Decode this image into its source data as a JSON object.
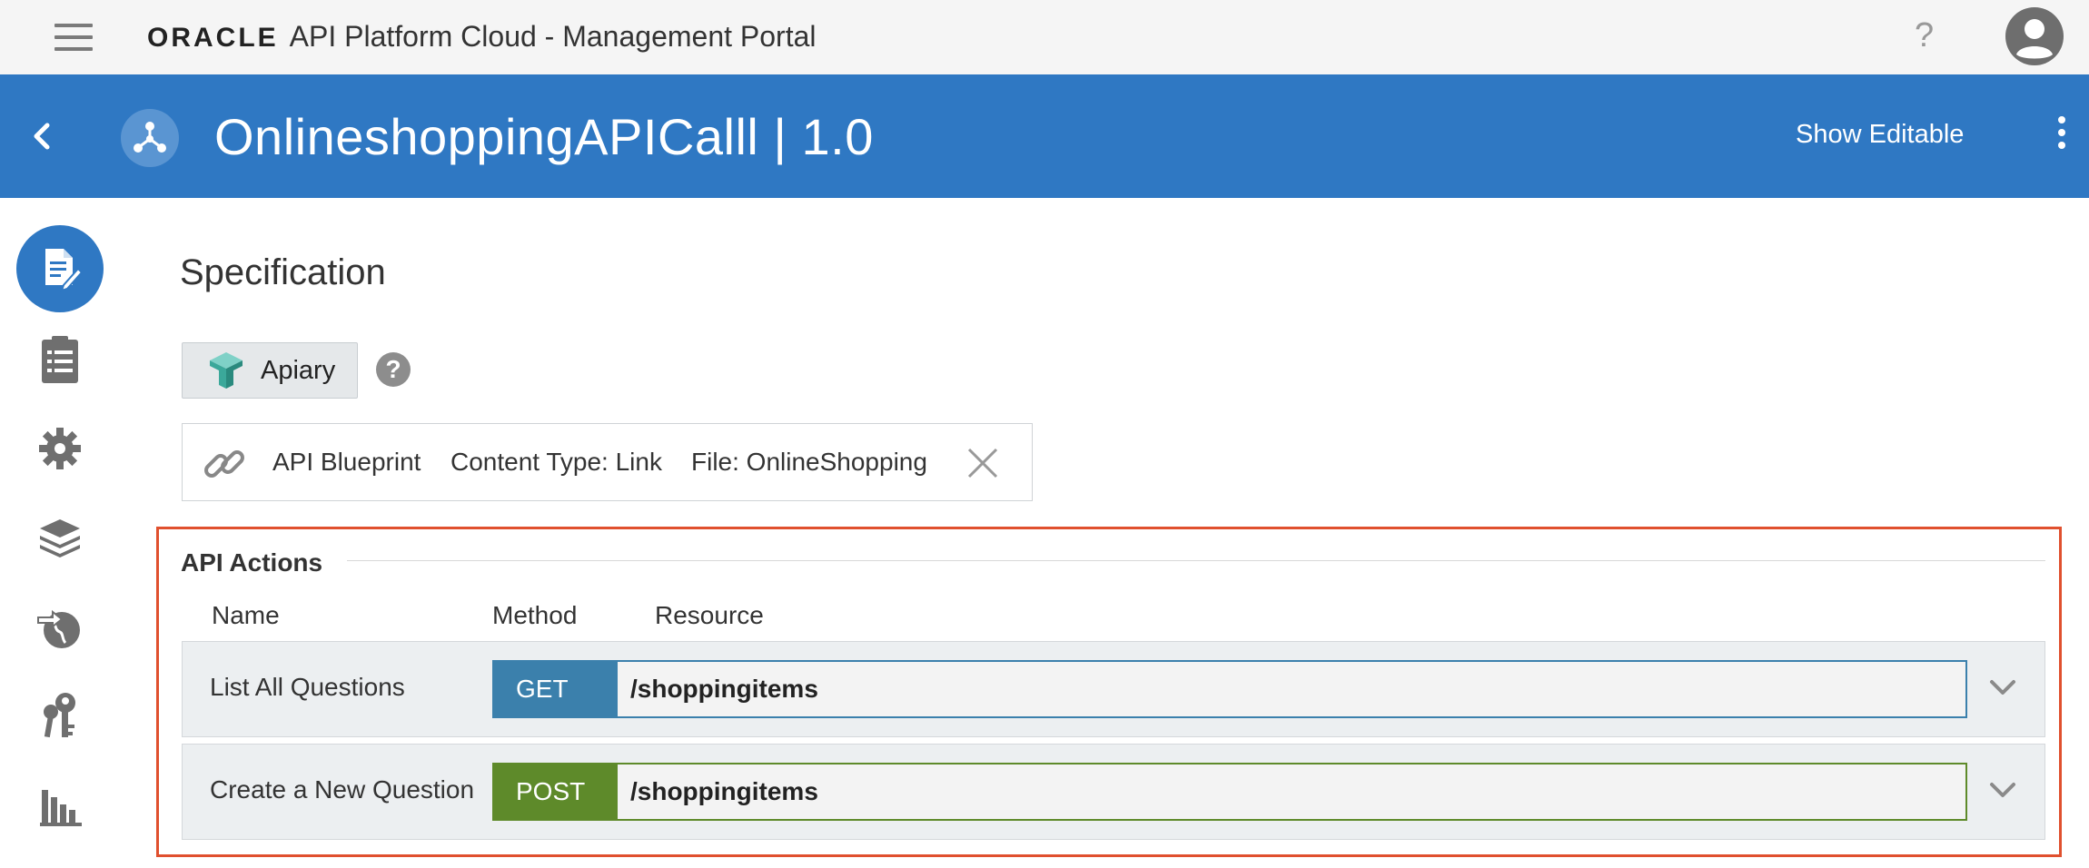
{
  "topbar": {
    "brand_logo": "ORACLE",
    "app_title": "API Platform Cloud - Management Portal",
    "help_label": "?"
  },
  "header": {
    "api_title": "OnlineshoppingAPICalll | 1.0",
    "show_editable": "Show Editable"
  },
  "sidebar": {
    "items": [
      {
        "icon": "document-edit-icon",
        "active": true
      },
      {
        "icon": "clipboard-list-icon",
        "active": false
      },
      {
        "icon": "gear-icon",
        "active": false
      },
      {
        "icon": "layers-icon",
        "active": false
      },
      {
        "icon": "globe-deploy-icon",
        "active": false
      },
      {
        "icon": "keys-icon",
        "active": false
      },
      {
        "icon": "bar-chart-icon",
        "active": false
      }
    ]
  },
  "main": {
    "section_title": "Specification",
    "apiary_button": "Apiary",
    "help_label": "?",
    "spec_file": {
      "format": "API Blueprint",
      "content_type": "Content Type: Link",
      "file": "File: OnlineShopping"
    },
    "api_actions": {
      "title": "API Actions",
      "columns": {
        "name": "Name",
        "method": "Method",
        "resource": "Resource"
      },
      "rows": [
        {
          "name": "List All Questions",
          "method": "GET",
          "resource": "/shoppingitems",
          "method_color": "#3b80ac",
          "border_color": "#3b80ac"
        },
        {
          "name": "Create a New Question",
          "method": "POST",
          "resource": "/shoppingitems",
          "method_color": "#5e8a2a",
          "border_color": "#5e8a2a"
        }
      ]
    }
  },
  "colors": {
    "header_blue": "#2f78c3",
    "highlight_frame": "#e0502e",
    "get_blue": "#3b80ac",
    "post_green": "#5e8a2a"
  }
}
